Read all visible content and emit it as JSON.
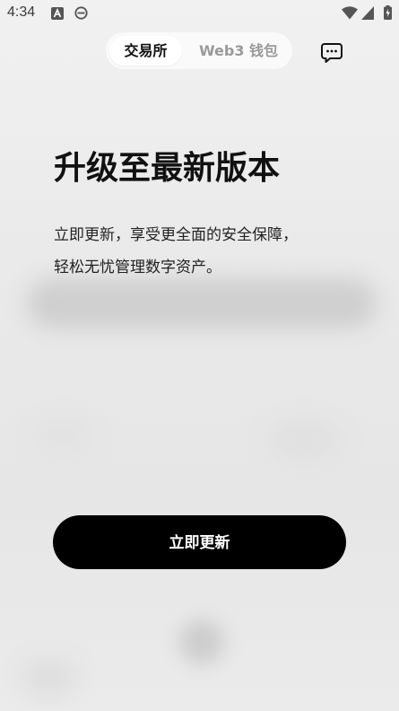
{
  "status_bar": {
    "time": "4:34",
    "icons": [
      "font-a-icon",
      "browser-e-icon",
      "wifi-icon",
      "cell-signal-icon",
      "battery-charging-icon"
    ]
  },
  "header": {
    "tabs": [
      {
        "label": "交易所",
        "active": true
      },
      {
        "label": "Web3 钱包",
        "active": false
      }
    ],
    "message_icon": "chat-bubble-icon"
  },
  "update": {
    "title": "升级至最新版本",
    "description_line1": "立即更新，享受更全面的安全保障，",
    "description_line2": "轻松无忧管理数字资产。",
    "button_label": "立即更新"
  },
  "colors": {
    "button_bg": "#000000",
    "button_text": "#ffffff",
    "title_text": "#111111",
    "inactive_tab": "#9a9a9a"
  }
}
